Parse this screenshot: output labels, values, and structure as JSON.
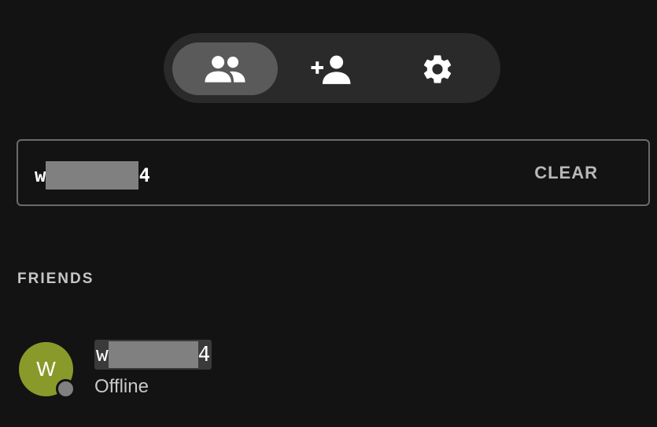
{
  "tabs": [
    {
      "id": "friends",
      "icon": "people-icon",
      "active": true
    },
    {
      "id": "add-friend",
      "icon": "add-person-icon",
      "active": false
    },
    {
      "id": "settings",
      "icon": "gear-icon",
      "active": false
    }
  ],
  "search": {
    "value_start": "w",
    "value_end": "4",
    "clear_label": "CLEAR"
  },
  "section": {
    "heading": "FRIENDS"
  },
  "friends": [
    {
      "initial": "W",
      "name_start": "w",
      "name_end": "4",
      "status": "Offline",
      "status_color": "#808080",
      "avatar_color": "#8a9a2a"
    }
  ],
  "colors": {
    "background": "#131313",
    "tabbar": "#2a2a2a",
    "active_tab": "#5a5a5a"
  }
}
